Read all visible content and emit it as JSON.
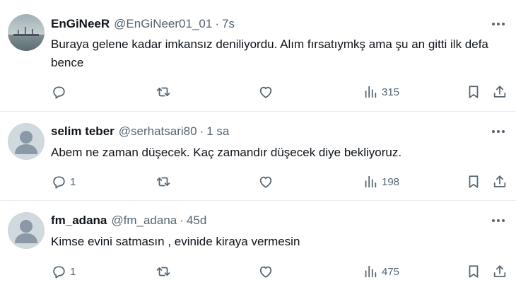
{
  "tweets": [
    {
      "name": "EnGiNeeR",
      "handle": "@EnGiNeer01_01",
      "separator": "·",
      "time": "7s",
      "text": "Buraya gelene kadar imkansız deniliyordu. Alım fırsatıymkş ama şu an gitti ilk defa bence",
      "replies": "",
      "retweets": "",
      "likes": "",
      "views": "315",
      "avatar": "photo"
    },
    {
      "name": "selim teber",
      "handle": "@serhatsari80",
      "separator": "·",
      "time": "1 sa",
      "text": "Abem ne zaman düşecek. Kaç zamandır düşecek diye bekliyoruz.",
      "replies": "1",
      "retweets": "",
      "likes": "",
      "views": "198",
      "avatar": "default"
    },
    {
      "name": "fm_adana",
      "handle": "@fm_adana",
      "separator": "·",
      "time": "45d",
      "text": "Kimse evini satmasın , evinide kiraya vermesin",
      "replies": "1",
      "retweets": "",
      "likes": "",
      "views": "475",
      "avatar": "default"
    }
  ],
  "icons": {
    "reply": "reply-icon",
    "retweet": "retweet-icon",
    "like": "like-icon",
    "views": "views-icon",
    "bookmark": "bookmark-icon",
    "share": "share-icon",
    "more": "more-icon"
  },
  "colors": {
    "text": "#0f1419",
    "secondary": "#536471",
    "divider": "#e6ecf0",
    "default_avatar": "#cfd9de"
  }
}
